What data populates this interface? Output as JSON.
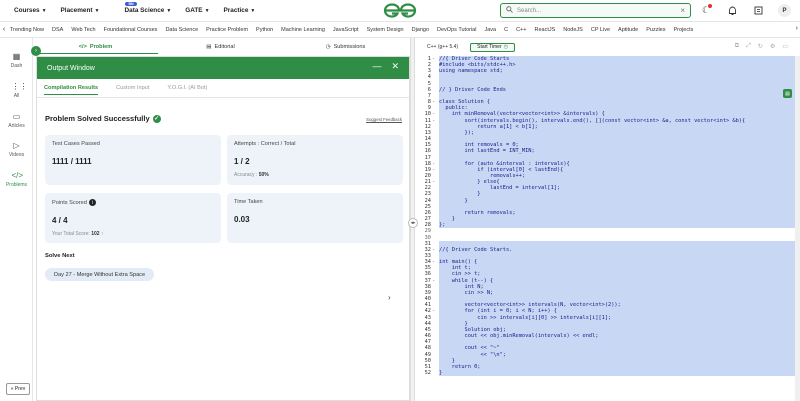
{
  "topnav": {
    "menu": [
      "Courses",
      "Placement",
      "Data Science",
      "GATE",
      "Practice"
    ],
    "new_badge": "BN",
    "search_placeholder": "Search...",
    "avatar_letter": "P"
  },
  "subnav": {
    "links": [
      "Trending Now",
      "DSA",
      "Web Tech",
      "Foundational Courses",
      "Data Science",
      "Practice Problem",
      "Python",
      "Machine Learning",
      "JavaScript",
      "System Design",
      "Django",
      "DevOps Tutorial",
      "Java",
      "C",
      "C++",
      "ReactJS",
      "NodeJS",
      "CP Live",
      "Aptitude",
      "Puzzles",
      "Projects"
    ]
  },
  "sidebar": {
    "items": [
      {
        "label": "Dash",
        "icon": "dashboard-icon",
        "active": false
      },
      {
        "label": "All",
        "icon": "grid-icon",
        "active": false
      },
      {
        "label": "Articles",
        "icon": "article-icon",
        "active": false
      },
      {
        "label": "Videos",
        "icon": "video-icon",
        "active": false
      },
      {
        "label": "Problems",
        "icon": "code-icon",
        "active": true
      }
    ],
    "prev_label": "« Prev"
  },
  "tabs": {
    "problem": "Problem",
    "editorial": "Editorial",
    "submissions": "Submissions"
  },
  "output_window": {
    "title": "Output Window",
    "tabs": [
      "Compilation Results",
      "Custom Input",
      "Y.O.G.I. (AI Bot)"
    ],
    "status": "Problem Solved Successfully",
    "feedback": "Suggest Feedback",
    "cards": {
      "test_cases_label": "Test Cases Passed",
      "test_cases_value": "1111 / 1111",
      "attempts_label": "Attempts : Correct / Total",
      "attempts_value": "1 / 2",
      "accuracy_label": "Accuracy :",
      "accuracy_value": "50%",
      "points_label": "Points Scored",
      "points_value": "4 / 4",
      "total_score_label": "Your Total Score:",
      "total_score_value": "102",
      "time_label": "Time Taken",
      "time_value": "0.03"
    },
    "solve_next_label": "Solve Next",
    "solve_next_item": "Day 27 - Merge Without Extra Space"
  },
  "editor": {
    "language": "C++ (g++ 5.4)",
    "timer_label": "Start Timer",
    "lines": [
      {
        "n": "1",
        "f": "-",
        "t": "//{ Driver Code Starts",
        "h": true
      },
      {
        "n": "2",
        "f": "",
        "t": "#include <bits/stdc++.h>",
        "h": true
      },
      {
        "n": "3",
        "f": "",
        "t": "using namespace std;",
        "h": true
      },
      {
        "n": "4",
        "f": "",
        "t": "",
        "h": true
      },
      {
        "n": "5",
        "f": "",
        "t": "",
        "h": true
      },
      {
        "n": "6",
        "f": "",
        "t": "// } Driver Code Ends",
        "h": true
      },
      {
        "n": "7",
        "f": "",
        "t": "",
        "h": true
      },
      {
        "n": "8",
        "f": "-",
        "t": "class Solution {",
        "h": true
      },
      {
        "n": "9",
        "f": "",
        "t": "  public:",
        "h": true
      },
      {
        "n": "10",
        "f": "-",
        "t": "    int minRemoval(vector<vector<int>> &intervals) {",
        "h": true
      },
      {
        "n": "11",
        "f": "-",
        "t": "        sort(intervals.begin(), intervals.end(), [](const vector<int> &a, const vector<int> &b){",
        "h": true
      },
      {
        "n": "12",
        "f": "",
        "t": "            return a[1] < b[1];",
        "h": true
      },
      {
        "n": "13",
        "f": "",
        "t": "        });",
        "h": true
      },
      {
        "n": "14",
        "f": "",
        "t": "",
        "h": true
      },
      {
        "n": "15",
        "f": "",
        "t": "        int removals = 0;",
        "h": true
      },
      {
        "n": "16",
        "f": "",
        "t": "        int lastEnd = INT_MIN;",
        "h": true
      },
      {
        "n": "17",
        "f": "",
        "t": "",
        "h": true
      },
      {
        "n": "18",
        "f": "-",
        "t": "        for (auto &interval : intervals){",
        "h": true
      },
      {
        "n": "19",
        "f": "-",
        "t": "            if (interval[0] < lastEnd){",
        "h": true
      },
      {
        "n": "20",
        "f": "",
        "t": "                removals++;",
        "h": true
      },
      {
        "n": "21",
        "f": "-",
        "t": "            } else{",
        "h": true
      },
      {
        "n": "22",
        "f": "",
        "t": "                lastEnd = interval[1];",
        "h": true
      },
      {
        "n": "23",
        "f": "",
        "t": "            }",
        "h": true
      },
      {
        "n": "24",
        "f": "",
        "t": "        }",
        "h": true
      },
      {
        "n": "25",
        "f": "",
        "t": "",
        "h": true
      },
      {
        "n": "26",
        "f": "",
        "t": "        return removals;",
        "h": true
      },
      {
        "n": "27",
        "f": "",
        "t": "    }",
        "h": true
      },
      {
        "n": "28",
        "f": "",
        "t": "};",
        "h": true
      },
      {
        "n": "29",
        "f": "",
        "t": "",
        "h": false
      },
      {
        "n": "30",
        "f": "",
        "t": "",
        "h": false
      },
      {
        "n": "31",
        "f": "",
        "t": "",
        "h": true
      },
      {
        "n": "32",
        "f": "-",
        "t": "//{ Driver Code Starts.",
        "h": true
      },
      {
        "n": "33",
        "f": "",
        "t": "",
        "h": true
      },
      {
        "n": "34",
        "f": "-",
        "t": "int main() {",
        "h": true
      },
      {
        "n": "35",
        "f": "",
        "t": "    int t;",
        "h": true
      },
      {
        "n": "36",
        "f": "",
        "t": "    cin >> t;",
        "h": true
      },
      {
        "n": "37",
        "f": "-",
        "t": "    while (t--) {",
        "h": true
      },
      {
        "n": "38",
        "f": "",
        "t": "        int N;",
        "h": true
      },
      {
        "n": "39",
        "f": "",
        "t": "        cin >> N;",
        "h": true
      },
      {
        "n": "40",
        "f": "",
        "t": "",
        "h": true
      },
      {
        "n": "41",
        "f": "",
        "t": "        vector<vector<int>> intervals(N, vector<int>(2));",
        "h": true
      },
      {
        "n": "42",
        "f": "-",
        "t": "        for (int i = 0; i < N; i++) {",
        "h": true
      },
      {
        "n": "43",
        "f": "",
        "t": "            cin >> intervals[i][0] >> intervals[i][1];",
        "h": true
      },
      {
        "n": "44",
        "f": "",
        "t": "        }",
        "h": true
      },
      {
        "n": "45",
        "f": "",
        "t": "        Solution obj;",
        "h": true
      },
      {
        "n": "46",
        "f": "",
        "t": "        cout << obj.minRemoval(intervals) << endl;",
        "h": true
      },
      {
        "n": "47",
        "f": "",
        "t": "",
        "h": true
      },
      {
        "n": "48",
        "f": "",
        "t": "        cout << \"~\"",
        "h": true
      },
      {
        "n": "49",
        "f": "",
        "t": "             << \"\\n\";",
        "h": true
      },
      {
        "n": "50",
        "f": "",
        "t": "    }",
        "h": true
      },
      {
        "n": "51",
        "f": "",
        "t": "    return 0;",
        "h": true
      },
      {
        "n": "52",
        "f": "",
        "t": "}",
        "h": true
      }
    ]
  },
  "colors": {
    "brand": "#2f8d46",
    "code_highlight": "#c7d7f4",
    "card_bg": "#eef3f9"
  }
}
